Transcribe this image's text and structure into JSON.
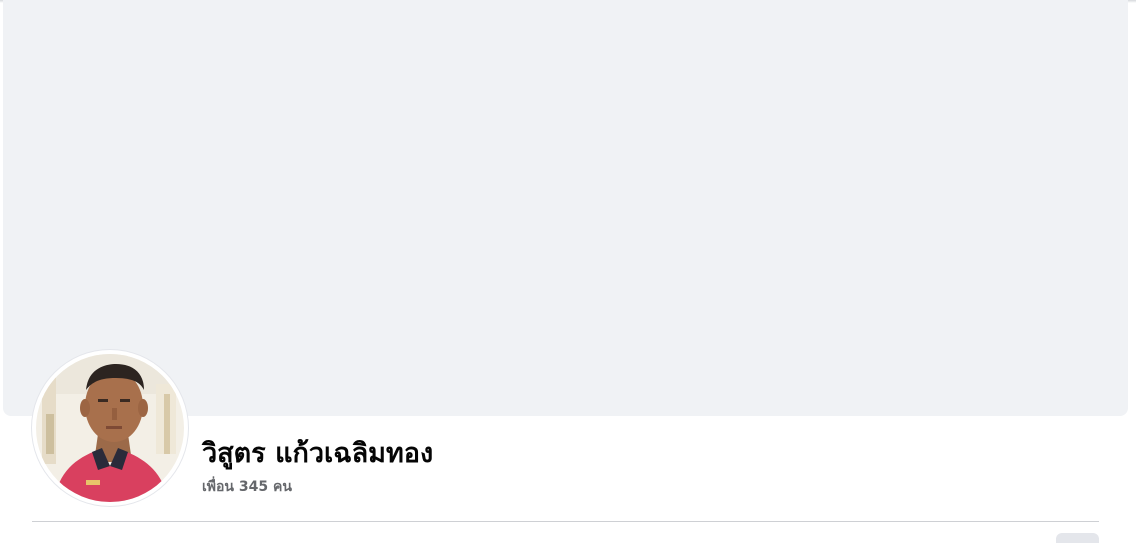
{
  "profile": {
    "name": "วิสูตร แก้วเฉลิมทอง",
    "friends_count": "เพื่อน 345 คน"
  },
  "icons": {
    "avatar": "profile-photo",
    "tab_button": "more-options"
  },
  "colors": {
    "cover_background": "#f0f2f5",
    "name_text": "#050505",
    "secondary_text": "#65676b",
    "divider": "#ced0d4"
  }
}
